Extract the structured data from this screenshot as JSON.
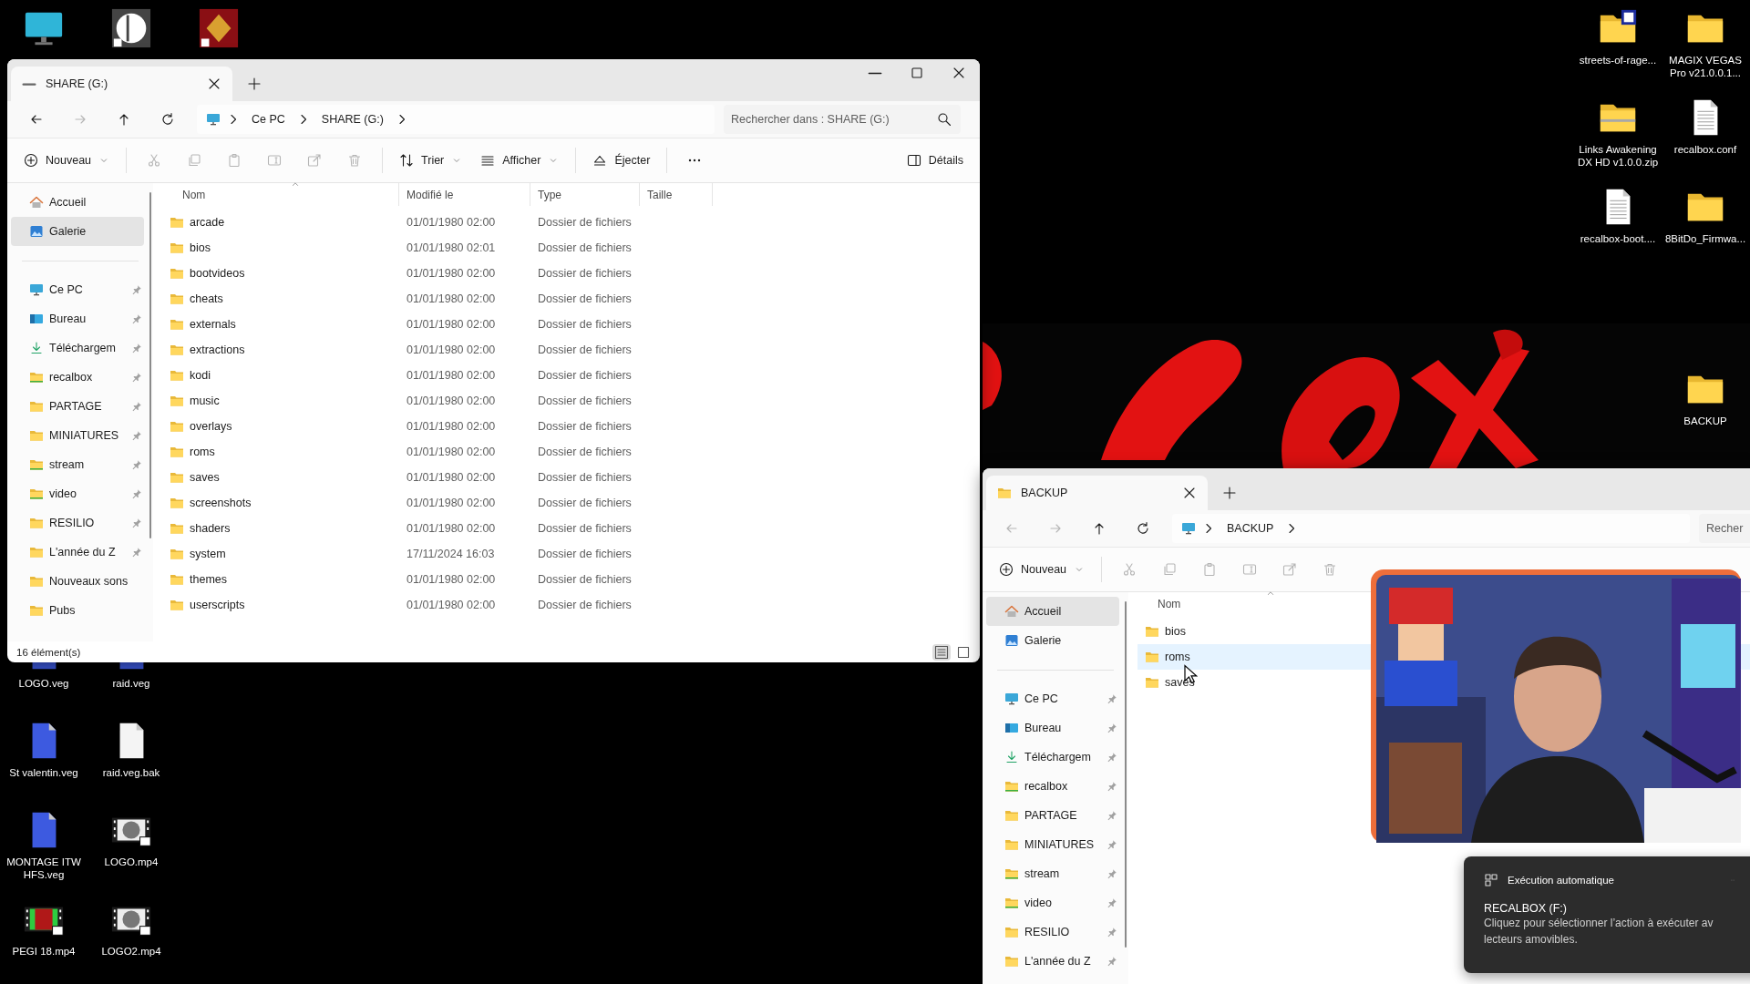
{
  "desktop": {
    "top_icons": [
      {
        "kind": "monitor"
      },
      {
        "kind": "app"
      },
      {
        "kind": "game-app"
      }
    ],
    "left_icons": [
      {
        "label": "LOGO.veg",
        "kind": "project"
      },
      {
        "label": "raid.veg",
        "kind": "project"
      },
      {
        "label": "St valentin.veg",
        "kind": "project"
      },
      {
        "label": "raid.veg.bak",
        "kind": "blank"
      },
      {
        "label": "MONTAGE ITW HFS.veg",
        "kind": "project"
      },
      {
        "label": "LOGO.mp4",
        "kind": "video"
      },
      {
        "label": "PEGI 18.mp4",
        "kind": "video-red"
      },
      {
        "label": "LOGO2.mp4",
        "kind": "video"
      }
    ],
    "right_icons": [
      {
        "label": "streets-of-rage...",
        "kind": "folder-badge"
      },
      {
        "label": "MAGIX VEGAS Pro v21.0.0.1...",
        "kind": "folder"
      },
      {
        "label": "Links Awakening DX HD v1.0.0.zip",
        "kind": "zip"
      },
      {
        "label": "recalbox.conf",
        "kind": "document"
      },
      {
        "label": "recalbox-boot....",
        "kind": "document"
      },
      {
        "label": "8BitDo_Firmwa...",
        "kind": "folder"
      }
    ],
    "backup_icon": {
      "label": "BACKUP",
      "kind": "folder"
    }
  },
  "share_window": {
    "tab": {
      "title": "SHARE (G:)",
      "kind": "drive"
    },
    "window_controls": [
      {
        "kind": "minimize"
      },
      {
        "kind": "maximize"
      },
      {
        "kind": "close"
      }
    ],
    "nav": [
      {
        "kind": "back",
        "disabled": false
      },
      {
        "kind": "forward",
        "disabled": true
      },
      {
        "kind": "up",
        "disabled": false
      },
      {
        "kind": "refresh",
        "disabled": false
      }
    ],
    "breadcrumb": [
      "Ce PC",
      "SHARE (G:)"
    ],
    "search": {
      "placeholder": "Rechercher dans : SHARE (G:)"
    },
    "toolbar": [
      {
        "kind": "new",
        "label": "Nouveau",
        "dropdown": true,
        "disabled": false
      },
      {
        "kind": "cut",
        "disabled": true
      },
      {
        "kind": "copy",
        "disabled": true
      },
      {
        "kind": "paste",
        "disabled": true
      },
      {
        "kind": "rename",
        "disabled": true
      },
      {
        "kind": "share",
        "disabled": true
      },
      {
        "kind": "delete",
        "disabled": true
      },
      {
        "kind": "sort",
        "label": "Trier",
        "dropdown": true,
        "disabled": false
      },
      {
        "kind": "view",
        "label": "Afficher",
        "dropdown": true,
        "disabled": false
      },
      {
        "kind": "eject",
        "label": "Éjecter",
        "dropdown": false,
        "disabled": false
      },
      {
        "kind": "more",
        "disabled": false
      }
    ],
    "details": {
      "label": "Détails"
    },
    "sidebar": {
      "groups": [
        [
          {
            "label": "Accueil",
            "kind": "home",
            "selected": false,
            "pinned": false
          },
          {
            "label": "Galerie",
            "kind": "gallery",
            "selected": true,
            "pinned": false
          }
        ],
        [
          {
            "label": "Ce PC",
            "kind": "pc",
            "selected": false,
            "pinned": true
          },
          {
            "label": "Bureau",
            "kind": "desktop",
            "selected": false,
            "pinned": true
          },
          {
            "label": "Téléchargem",
            "kind": "download",
            "selected": false,
            "pinned": true
          },
          {
            "label": "recalbox",
            "kind": "folder-green",
            "selected": false,
            "pinned": true
          },
          {
            "label": "PARTAGE",
            "kind": "folder",
            "selected": false,
            "pinned": true
          },
          {
            "label": "MINIATURES",
            "kind": "folder",
            "selected": false,
            "pinned": true
          },
          {
            "label": "stream",
            "kind": "folder-green",
            "selected": false,
            "pinned": true
          },
          {
            "label": "video",
            "kind": "folder-green",
            "selected": false,
            "pinned": true
          },
          {
            "label": "RESILIO",
            "kind": "folder",
            "selected": false,
            "pinned": true
          },
          {
            "label": "L'année du Z",
            "kind": "folder",
            "selected": false,
            "pinned": true
          },
          {
            "label": "Nouveaux sons",
            "kind": "folder",
            "selected": false,
            "pinned": false
          },
          {
            "label": "Pubs",
            "kind": "folder",
            "selected": false,
            "pinned": false
          }
        ]
      ]
    },
    "columns": [
      "Nom",
      "Modifié le",
      "Type",
      "Taille"
    ],
    "files": [
      {
        "name": "arcade",
        "modified": "01/01/1980 02:00",
        "type": "Dossier de fichiers",
        "hovered": false
      },
      {
        "name": "bios",
        "modified": "01/01/1980 02:01",
        "type": "Dossier de fichiers",
        "hovered": false
      },
      {
        "name": "bootvideos",
        "modified": "01/01/1980 02:00",
        "type": "Dossier de fichiers",
        "hovered": false
      },
      {
        "name": "cheats",
        "modified": "01/01/1980 02:00",
        "type": "Dossier de fichiers",
        "hovered": false
      },
      {
        "name": "externals",
        "modified": "01/01/1980 02:00",
        "type": "Dossier de fichiers",
        "hovered": false
      },
      {
        "name": "extractions",
        "modified": "01/01/1980 02:00",
        "type": "Dossier de fichiers",
        "hovered": false
      },
      {
        "name": "kodi",
        "modified": "01/01/1980 02:00",
        "type": "Dossier de fichiers",
        "hovered": false
      },
      {
        "name": "music",
        "modified": "01/01/1980 02:00",
        "type": "Dossier de fichiers",
        "hovered": false
      },
      {
        "name": "overlays",
        "modified": "01/01/1980 02:00",
        "type": "Dossier de fichiers",
        "hovered": false
      },
      {
        "name": "roms",
        "modified": "01/01/1980 02:00",
        "type": "Dossier de fichiers",
        "hovered": false
      },
      {
        "name": "saves",
        "modified": "01/01/1980 02:00",
        "type": "Dossier de fichiers",
        "hovered": false
      },
      {
        "name": "screenshots",
        "modified": "01/01/1980 02:00",
        "type": "Dossier de fichiers",
        "hovered": false
      },
      {
        "name": "shaders",
        "modified": "01/01/1980 02:00",
        "type": "Dossier de fichiers",
        "hovered": false
      },
      {
        "name": "system",
        "modified": "17/11/2024 16:03",
        "type": "Dossier de fichiers",
        "hovered": false
      },
      {
        "name": "themes",
        "modified": "01/01/1980 02:00",
        "type": "Dossier de fichiers",
        "hovered": false
      },
      {
        "name": "userscripts",
        "modified": "01/01/1980 02:00",
        "type": "Dossier de fichiers",
        "hovered": false
      }
    ],
    "status": "16 élément(s)",
    "view_modes": [
      {
        "kind": "list",
        "selected": true
      },
      {
        "kind": "tiles",
        "selected": false
      }
    ]
  },
  "backup_window": {
    "tab": {
      "title": "BACKUP",
      "kind": "folder"
    },
    "nav": [
      {
        "kind": "back",
        "disabled": true
      },
      {
        "kind": "forward",
        "disabled": true
      },
      {
        "kind": "up",
        "disabled": false
      },
      {
        "kind": "refresh",
        "disabled": false
      }
    ],
    "breadcrumb": [
      "BACKUP"
    ],
    "search": {
      "placeholder": "Recher"
    },
    "toolbar": [
      {
        "kind": "new",
        "label": "Nouveau",
        "dropdown": true,
        "disabled": false
      },
      {
        "kind": "cut",
        "disabled": true
      },
      {
        "kind": "copy",
        "disabled": true
      },
      {
        "kind": "paste",
        "disabled": true
      },
      {
        "kind": "rename",
        "disabled": true
      },
      {
        "kind": "share",
        "disabled": true
      },
      {
        "kind": "delete",
        "disabled": true
      }
    ],
    "sidebar": {
      "groups": [
        [
          {
            "label": "Accueil",
            "kind": "home",
            "selected": true,
            "pinned": false
          },
          {
            "label": "Galerie",
            "kind": "gallery",
            "selected": false,
            "pinned": false
          }
        ],
        [
          {
            "label": "Ce PC",
            "kind": "pc",
            "selected": false,
            "pinned": true
          },
          {
            "label": "Bureau",
            "kind": "desktop",
            "selected": false,
            "pinned": true
          },
          {
            "label": "Téléchargem",
            "kind": "download",
            "selected": false,
            "pinned": true
          },
          {
            "label": "recalbox",
            "kind": "folder-green",
            "selected": false,
            "pinned": true
          },
          {
            "label": "PARTAGE",
            "kind": "folder",
            "selected": false,
            "pinned": true
          },
          {
            "label": "MINIATURES",
            "kind": "folder",
            "selected": false,
            "pinned": true
          },
          {
            "label": "stream",
            "kind": "folder-green",
            "selected": false,
            "pinned": true
          },
          {
            "label": "video",
            "kind": "folder-green",
            "selected": false,
            "pinned": true
          },
          {
            "label": "RESILIO",
            "kind": "folder",
            "selected": false,
            "pinned": true
          },
          {
            "label": "L'année du Z",
            "kind": "folder",
            "selected": false,
            "pinned": true
          }
        ]
      ]
    },
    "columns": [
      "Nom"
    ],
    "files": [
      {
        "name": "bios",
        "hovered": false
      },
      {
        "name": "roms",
        "hovered": true
      },
      {
        "name": "saves",
        "hovered": false
      }
    ]
  },
  "notification": {
    "app": "Exécution automatique",
    "title": "RECALBOX (F:)",
    "body": [
      "Cliquez pour sélectionner l’action à exécuter av",
      "lecteurs amovibles."
    ]
  }
}
